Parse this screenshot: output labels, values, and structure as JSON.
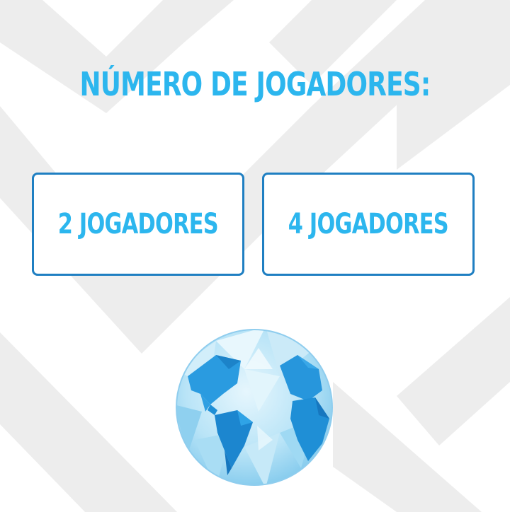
{
  "screen": {
    "title": "NÚMERO DE JOGADORES:"
  },
  "options": [
    {
      "label": "2 JOGADORES"
    },
    {
      "label": "4 JOGADORES"
    }
  ],
  "colors": {
    "accent_text": "#2cb6ee",
    "button_border": "#1f7fc2",
    "background_pattern": "#ededed",
    "globe_ocean": "#b9e4f7",
    "globe_land": "#1f8fd6"
  },
  "icons": {
    "globe": "world-globe-icon"
  }
}
